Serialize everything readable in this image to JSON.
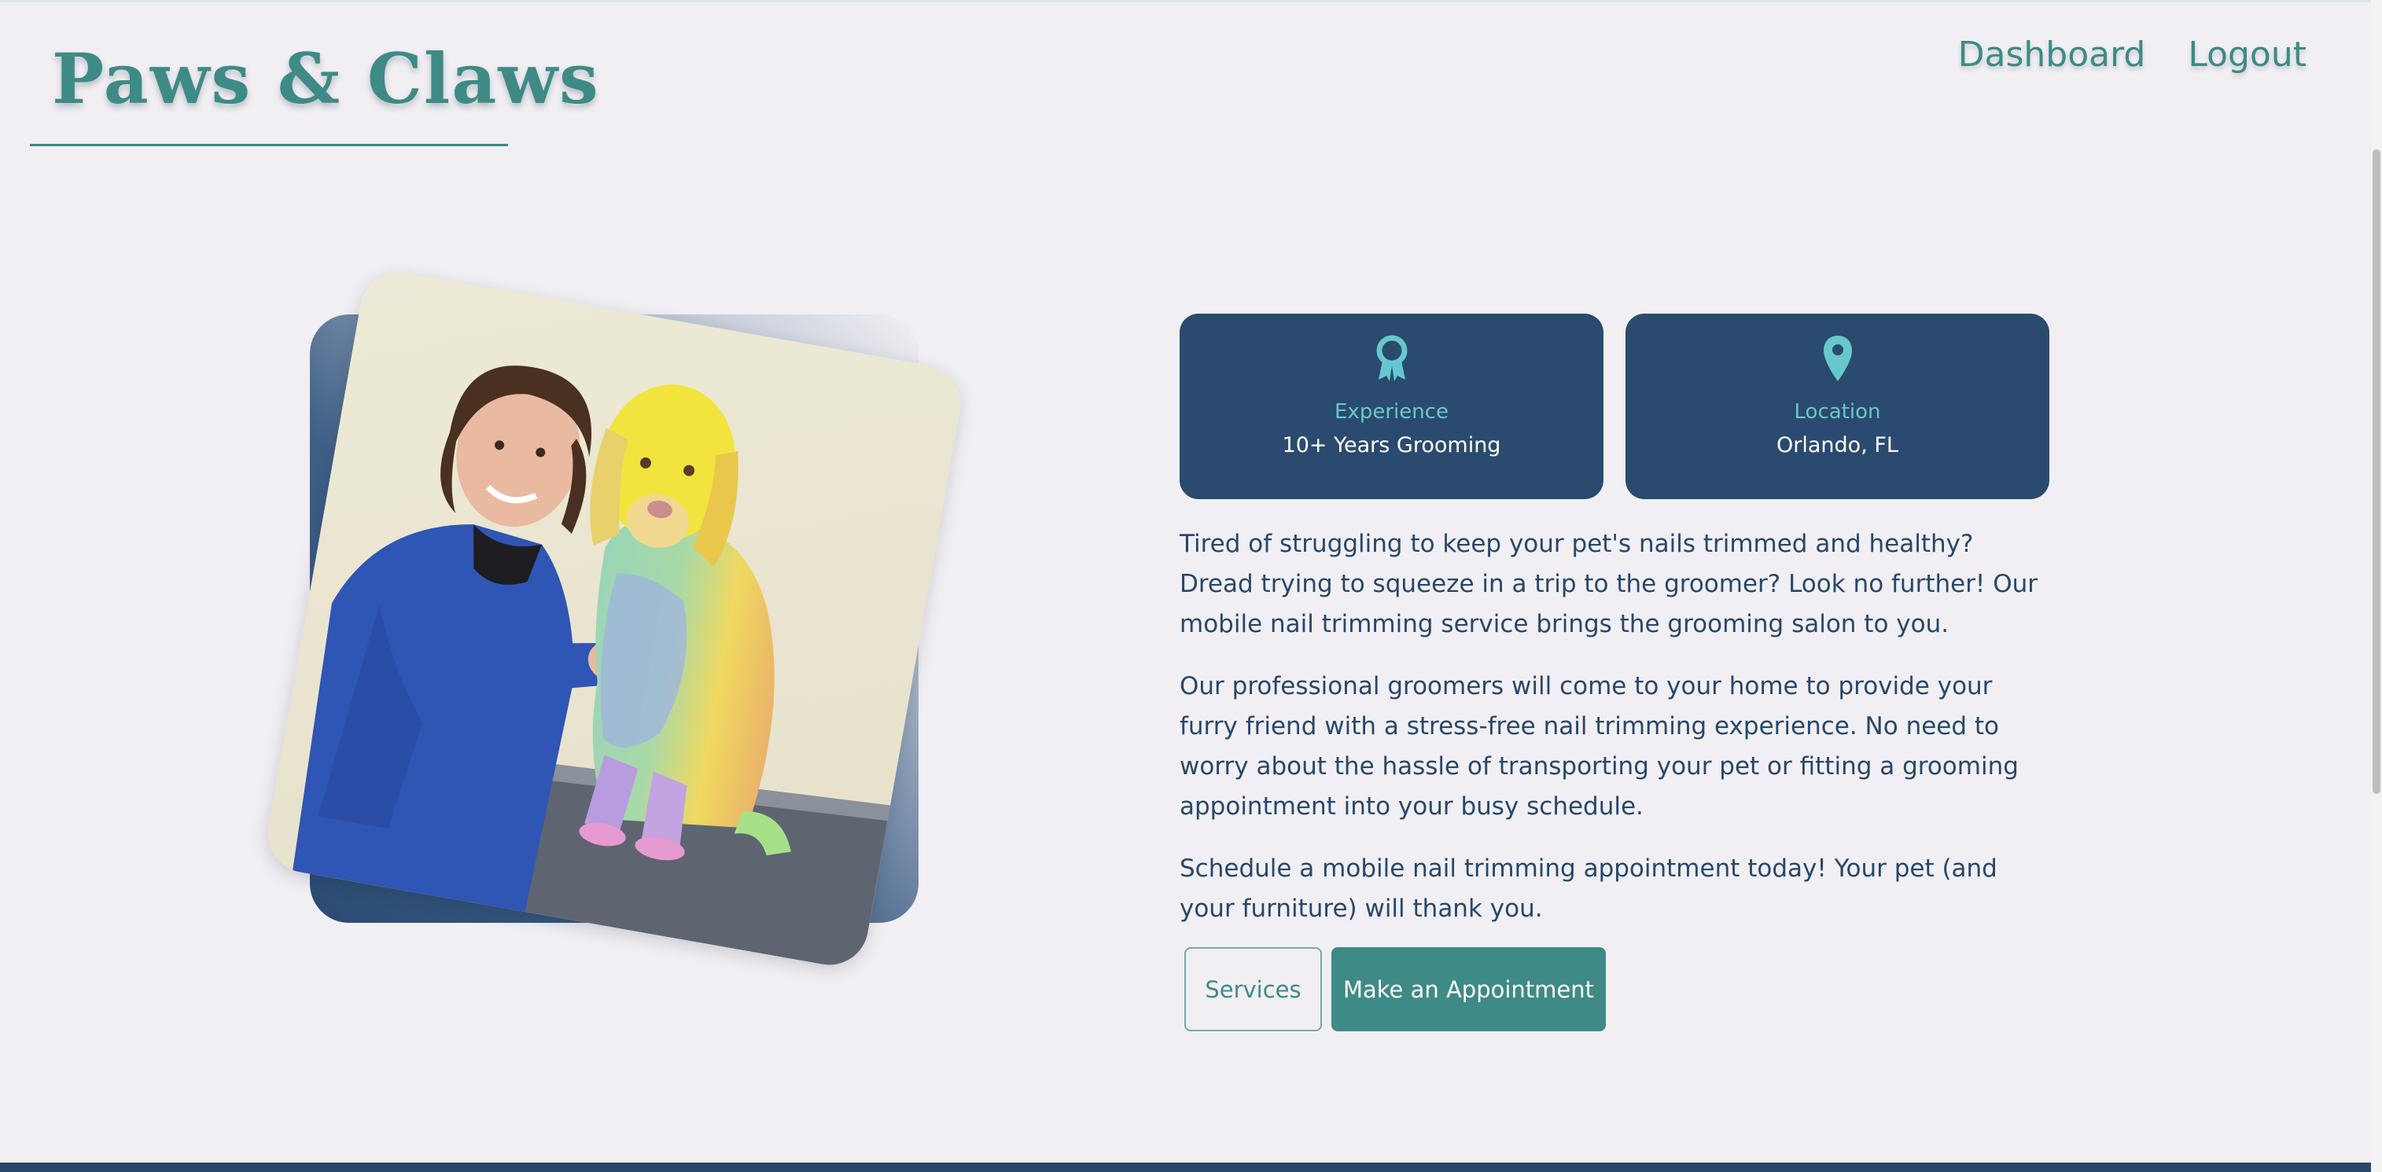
{
  "header": {
    "brand": "Paws & Claws",
    "nav": {
      "dashboard": "Dashboard",
      "logout": "Logout"
    }
  },
  "hero": {
    "image_alt": "Groomer with a rainbow-dyed dog on a grooming table",
    "cards": [
      {
        "icon": "award-ribbon-icon",
        "title": "Experience",
        "value": "10+ Years Grooming"
      },
      {
        "icon": "map-pin-icon",
        "title": "Location",
        "value": "Orlando, FL"
      }
    ],
    "paragraphs": [
      "Tired of struggling to keep your pet's nails trimmed and healthy? Dread trying to squeeze in a trip to the groomer? Look no further! Our mobile nail trimming service brings the grooming salon to you.",
      "Our professional groomers will come to your home to provide your furry friend with a stress-free nail trimming experience. No need to worry about the hassle of transporting your pet or fitting a grooming appointment into your busy schedule.",
      "Schedule a mobile nail trimming appointment today! Your pet (and your furniture) will thank you."
    ],
    "buttons": {
      "services": "Services",
      "appointment": "Make an Appointment"
    }
  },
  "colors": {
    "accent": "#3e8a86",
    "card_bg": "#2b4a6f",
    "card_title": "#67c8cc",
    "text": "#27476b",
    "background": "#f1eff3"
  }
}
